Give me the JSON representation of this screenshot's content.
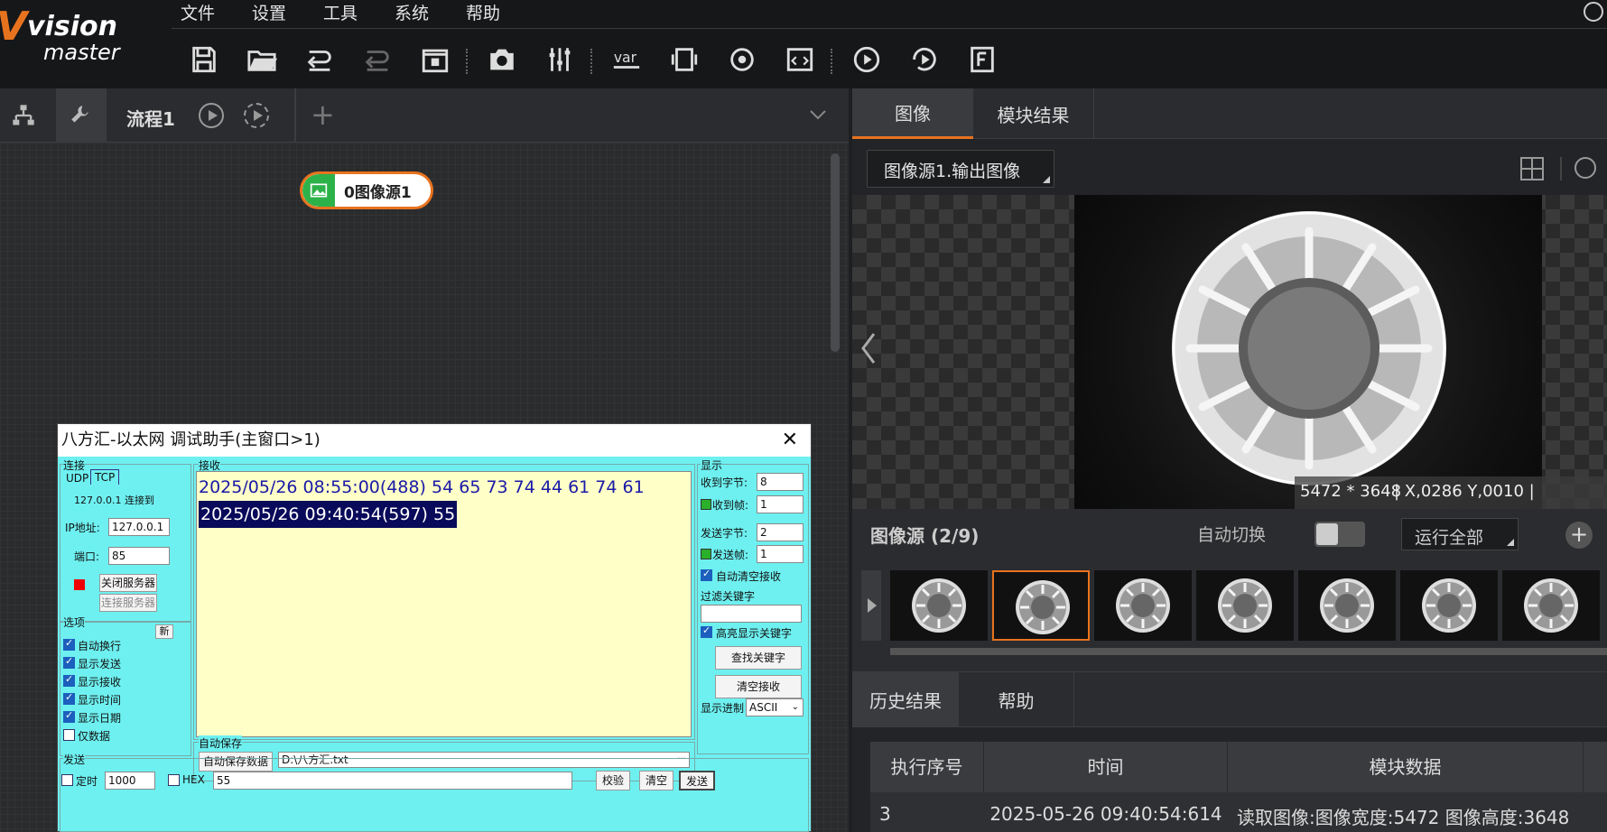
{
  "app": {
    "logo_v": "V",
    "logo_vision": "vision",
    "logo_master": "master"
  },
  "menu": [
    "文件",
    "设置",
    "工具",
    "系统",
    "帮助"
  ],
  "toolbar": {
    "icons": [
      "save-icon",
      "open-folder-icon",
      "undo-icon",
      "redo-icon",
      "lock-icon",
      "camera-icon",
      "sliders-icon",
      "variable-icon",
      "device-icon",
      "target-icon",
      "code-icon",
      "run-icon",
      "run-loop-icon",
      "font-icon"
    ]
  },
  "flow": {
    "tab_label": "流程1",
    "node_label": "0图像源1"
  },
  "right_panel": {
    "tabs": [
      "图像",
      "模块结果"
    ],
    "image_select": "图像源1.输出图像",
    "resolution": "5472 * 3648",
    "coords": "| X,0286  Y,0010  |",
    "source_title": "图像源 (2/9)",
    "auto_switch": "自动切换",
    "run_all": "运行全部",
    "bottom_tabs": [
      "历史结果",
      "帮助"
    ],
    "table": {
      "headers": [
        "执行序号",
        "时间",
        "模块数据"
      ],
      "rows": [
        [
          "3",
          "2025-05-26 09:40:54:614",
          "读取图像:图像宽度:5472 图像高度:3648"
        ]
      ]
    }
  },
  "dialog": {
    "title": "八方汇-以太网 调试助手(主窗口>1)",
    "conn_group": "连接",
    "udp_tab": "UDP",
    "tcp_tab": "TCP",
    "connected_to": "127.0.0.1 连接到",
    "ip_label": "IP地址:",
    "ip_value": "127.0.0.1",
    "port_label": "端口:",
    "port_value": "85",
    "close_server": "关闭服务器",
    "connect_server": "连接服务器",
    "options_group": "选项",
    "new_btn": "新",
    "options": [
      {
        "label": "自动换行",
        "checked": true
      },
      {
        "label": "显示发送",
        "checked": true
      },
      {
        "label": "显示接收",
        "checked": true
      },
      {
        "label": "显示时间",
        "checked": true
      },
      {
        "label": "显示日期",
        "checked": true
      },
      {
        "label": "仅数据",
        "checked": false
      }
    ],
    "recv_group": "接收",
    "recv_lines": [
      "2025/05/26  08:55:00(488)  54 65 73 74 44 61 74 61",
      "2025/05/26  09:40:54(597)  55"
    ],
    "autosave_group": "自动保存",
    "autosave_btn": "自动保存数据",
    "autosave_path": "D:\\八方汇.txt",
    "display_group": "显示",
    "recv_bytes_label": "收到字节:",
    "recv_bytes": "8",
    "recv_frames_label": "收到帧:",
    "recv_frames": "1",
    "send_bytes_label": "发送字节:",
    "send_bytes": "2",
    "send_frames_label": "发送帧:",
    "send_frames": "1",
    "auto_clear": "自动清空接收",
    "filter_label": "过滤关键字",
    "highlight": "高亮显示关键字",
    "find_btn": "查找关键字",
    "clear_recv_btn": "清空接收",
    "display_mode_label": "显示进制",
    "display_mode": "ASCII",
    "send_group": "发送",
    "timer_label": "定时",
    "timer_value": "1000",
    "hex_label": "HEX",
    "send_text": "55",
    "check_btn": "校验",
    "clear_btn": "清空",
    "send_btn": "发送"
  }
}
